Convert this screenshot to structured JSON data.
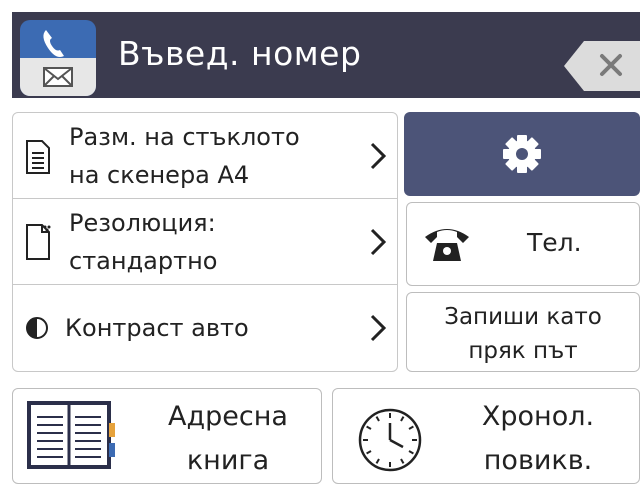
{
  "header": {
    "title": "Въвед. номер",
    "accent_color": "#3c6bb3",
    "bar_color": "#3b3b4f"
  },
  "settings": [
    {
      "icon": "document-icon",
      "line1": "Разм. на стъклото",
      "line2": "на скенера А4"
    },
    {
      "icon": "resolution-icon",
      "line1": "Резолюция:",
      "line2": "стандартно"
    },
    {
      "icon": "contrast-icon",
      "line1": "Контраст авто"
    }
  ],
  "buttons": {
    "settings_icon": "gear-icon",
    "tel_label": "Тел.",
    "save_line1": "Запиши като",
    "save_line2": "пряк път",
    "address_line1": "Адресна",
    "address_line2": "книга",
    "history_line1": "Хронол.",
    "history_line2": "повикв."
  }
}
